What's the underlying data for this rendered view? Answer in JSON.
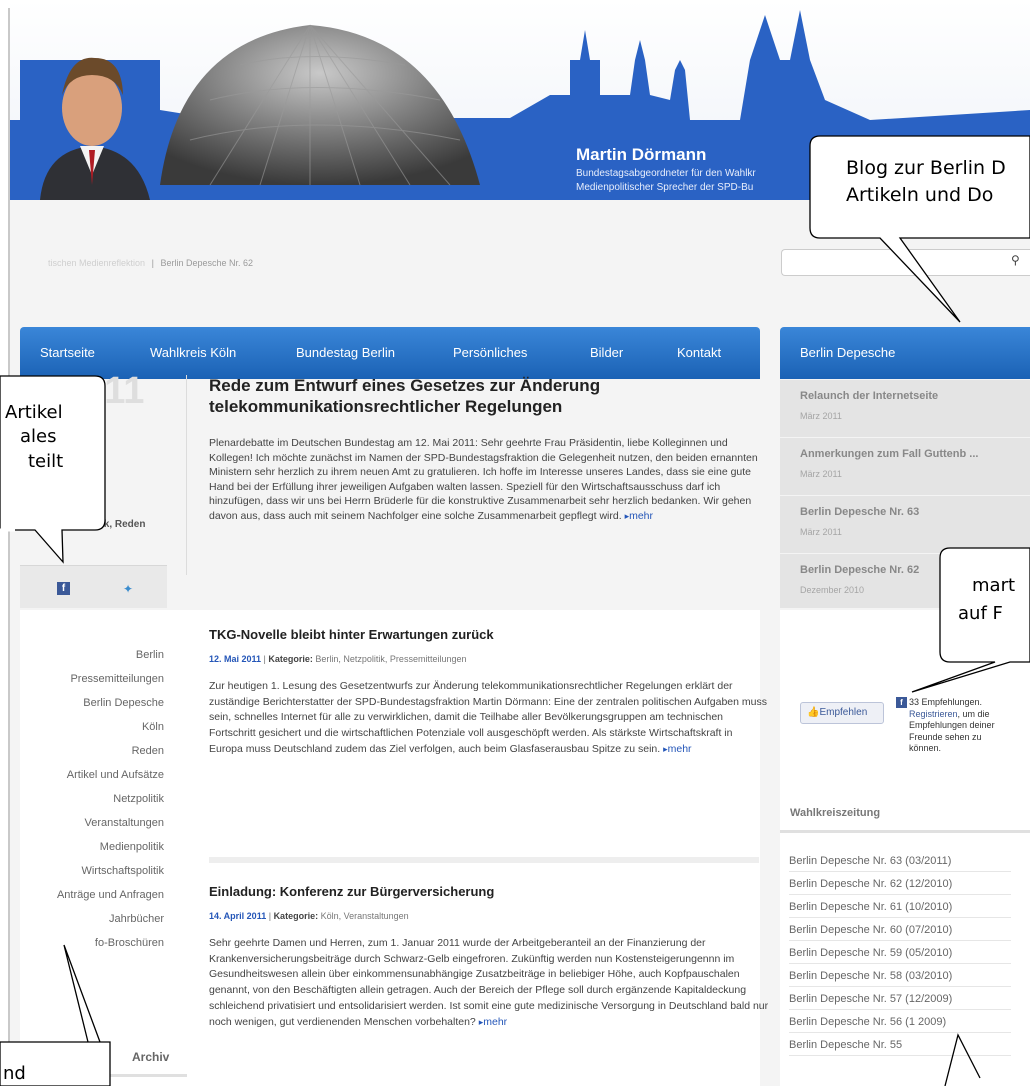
{
  "header": {
    "name": "Martin Dörmann",
    "subline_1": "Bundestagsabgeordneter für den Wahlkr",
    "subline_2": "Medienpolitischer Sprecher der SPD-Bu"
  },
  "breadcrumb": {
    "faded": "tischen Medienreflektion",
    "separator": "|",
    "current": "Berlin Depesche Nr. 62"
  },
  "search": {
    "placeholder": "",
    "icon": "search-icon"
  },
  "nav": {
    "items": [
      {
        "label": "Startseite"
      },
      {
        "label": "Wahlkreis Köln"
      },
      {
        "label": "Bundestag Berlin"
      },
      {
        "label": "Persönliches"
      },
      {
        "label": "Bilder"
      },
      {
        "label": "Kontakt"
      }
    ]
  },
  "depesche": {
    "heading": "Berlin Depesche",
    "items": [
      {
        "title": "Relaunch der Internetseite",
        "date": "März 2011"
      },
      {
        "title": "Anmerkungen zum Fall Guttenb ...",
        "date": "März 2011"
      },
      {
        "title": "Berlin Depesche Nr. 63",
        "date": "März 2011"
      },
      {
        "title": "Berlin Depesche Nr. 62",
        "date": "Dezember 2010"
      }
    ]
  },
  "featured": {
    "year": "2011",
    "categories": "etzpolitik, Reden",
    "title": "Rede zum Entwurf eines Gesetzes zur Änderung telekommunikationsrechtlicher Regelungen",
    "body": "Plenardebatte im Deutschen Bundestag am 12. Mai 2011: Sehr geehrte Frau Präsidentin, liebe Kolleginnen und Kollegen! Ich möchte zunächst im Namen der SPD-Bundestagsfraktion die Gelegenheit nutzen, den beiden ernannten Ministern sehr herzlich zu ihrem neuen Amt zu gratulieren. Ich hoffe im Interesse unseres Landes, dass sie eine gute Hand bei der Erfüllung ihrer jeweiligen Aufgaben walten lassen. Speziell für den Wirtschaftsausschuss darf ich hinzufügen, dass wir uns bei Herrn Brüderle für die konstruktive Zusammenarbeit sehr herzlich bedanken. Wir gehen davon aus, dass auch mit seinem Nachfolger eine solche Zusammenarbeit gepflegt wird.",
    "more": "mehr"
  },
  "categories": [
    "Berlin",
    "Pressemitteilungen",
    "Berlin Depesche",
    "Köln",
    "Reden",
    "Artikel und Aufsätze",
    "Netzpolitik",
    "Veranstaltungen",
    "Medienpolitik",
    "Wirtschaftspolitik",
    "Anträge und Anfragen",
    "Jahrbücher",
    "fo-Broschüren"
  ],
  "archiv": "Archiv",
  "posts": [
    {
      "title": "TKG-Novelle bleibt hinter Erwartungen zurück",
      "date": "12. Mai 2011",
      "sep": " | ",
      "kat_label": "Kategorie:",
      "kat": " Berlin, Netzpolitik, Pressemitteilungen",
      "body": "Zur heutigen 1. Lesung des Gesetzentwurfs zur Änderung telekommunikationsrechtlicher Regelungen erklärt der zuständige Berichterstatter der SPD-Bundestagsfraktion Martin Dörmann: Eine der zentralen politischen Aufgaben muss sein, schnelles Internet für alle zu verwirklichen, damit die Teilhabe aller Bevölkerungsgruppen am technischen Fortschritt gesichert und die wirtschaftlichen Potenziale voll ausgeschöpft werden. Als stärkste Wirtschaftskraft in Europa muss Deutschland zudem das Ziel verfolgen, auch beim Glasfaserausbau Spitze zu sein.",
      "more": "mehr"
    },
    {
      "title": "Einladung: Konferenz zur Bürgerversicherung",
      "date": "14. April 2011",
      "sep": " | ",
      "kat_label": "Kategorie:",
      "kat": " Köln, Veranstaltungen",
      "body": "Sehr geehrte Damen und Herren, zum 1. Januar 2011 wurde der Arbeitgeberanteil an der Finanzierung der Krankenversicherungsbeiträge durch Schwarz-Gelb eingefroren. Zukünftig werden nun Kostensteigerungennn im Gesundheitswesen allein über einkommensunabhängige Zusatzbeiträge in beliebiger Höhe, auch Kopfpauschalen genannt, von den Beschäftigten allein getragen. Auch der Bereich der Pflege soll durch ergänzende Kapitaldeckung schleichend privatisiert und entsolidarisiert werden. Ist somit eine gute medizinische Versorgung in Deutschland bald nur noch wenigen, gut verdienenden Menschen vorbehalten?",
      "more": "mehr"
    }
  ],
  "facebook": {
    "button": "Empfehlen",
    "count_text": "33 Empfehlungen.",
    "link": "Registrieren",
    "rest": ", um die Empfehlungen deiner Freunde sehen zu können."
  },
  "wahlkreis": {
    "heading": "Wahlkreiszeitung",
    "items": [
      "Berlin Depesche Nr. 63 (03/2011)",
      "Berlin Depesche Nr. 62 (12/2010)",
      "Berlin Depesche Nr. 61 (10/2010)",
      "Berlin Depesche Nr. 60 (07/2010)",
      "Berlin Depesche Nr. 59 (05/2010)",
      "Berlin Depesche Nr. 58 (03/2010)",
      "Berlin Depesche Nr. 57 (12/2009)",
      "Berlin Depesche Nr. 56 (1 2009)",
      "Berlin Depesche Nr. 55"
    ]
  },
  "callouts": {
    "top_right_1": "Blog zur Berlin D",
    "top_right_2": "Artikeln und Do",
    "left_1": "Artikel",
    "left_2": "ales",
    "left_3": "teilt",
    "fb_1": "mart",
    "fb_2": "auf F",
    "bottom_left": "nd"
  },
  "colors": {
    "nav_blue": "#1b62b5",
    "link_blue": "#2456b8",
    "skyline": "#2a62c4"
  }
}
